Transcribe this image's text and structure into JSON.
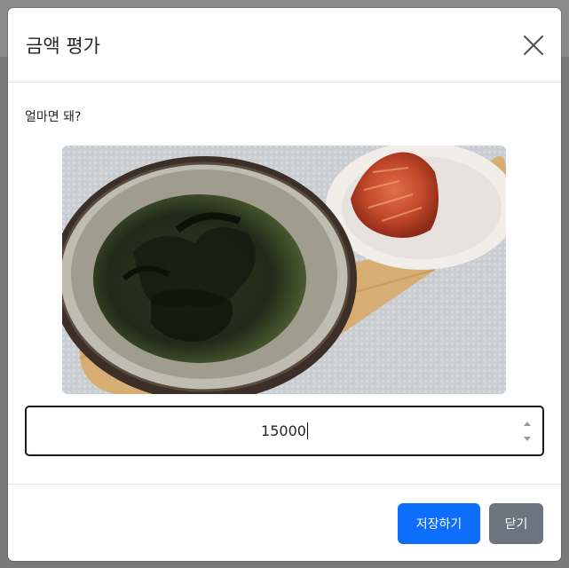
{
  "modal": {
    "title": "금액 평가",
    "close_icon": "close-icon"
  },
  "body": {
    "question": "얼마면 돼?",
    "photo_subject": "food-photo",
    "amount_value": "15000"
  },
  "footer": {
    "save_label": "저장하기",
    "close_label": "닫기"
  },
  "colors": {
    "primary": "#0d6efd",
    "secondary": "#6c757d",
    "border": "#dee2e6",
    "text": "#212529"
  }
}
